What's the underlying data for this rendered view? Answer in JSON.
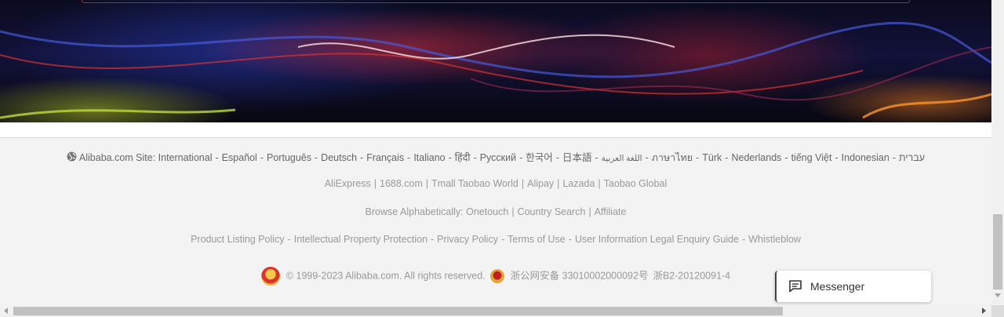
{
  "sites": {
    "prefix": "Alibaba.com Site:",
    "links": [
      "International",
      "Español",
      "Português",
      "Deutsch",
      "Français",
      "Italiano",
      "हिंदी",
      "Pусский",
      "한국어",
      "日本語",
      "اللغة العربية",
      "ภาษาไทย",
      "Türk",
      "Nederlands",
      "tiếng Việt",
      "Indonesian",
      "עברית"
    ]
  },
  "partners": [
    "AliExpress",
    "1688.com",
    "Tmall Taobao World",
    "Alipay",
    "Lazada",
    "Taobao Global"
  ],
  "browse": {
    "prefix": "Browse Alphabetically:",
    "links": [
      "Onetouch",
      "Country Search",
      "Affiliate"
    ]
  },
  "policies": [
    "Product Listing Policy",
    "Intellectual Property Protection",
    "Privacy Policy",
    "Terms of Use",
    "User Information Legal Enquiry Guide",
    "Whistleblow"
  ],
  "legal": {
    "copyright": "© 1999-2023 Alibaba.com. All rights reserved.",
    "police_record": "浙公网安备 33010002000092号",
    "icp": "浙B2-20120091-4"
  },
  "messenger": {
    "label": "Messenger",
    "icon": "chat-icon"
  },
  "icons": {
    "globe": "globe-icon",
    "emblem": "national-emblem-icon",
    "police": "police-badge-icon"
  }
}
